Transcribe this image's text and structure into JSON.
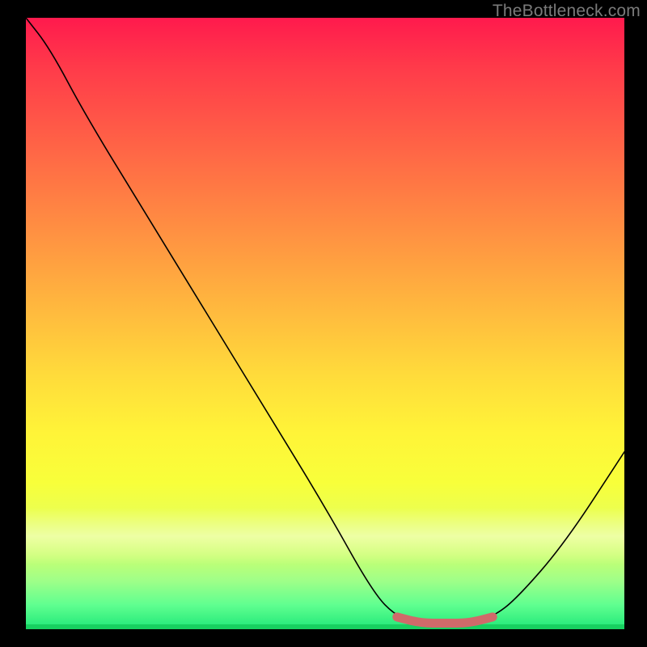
{
  "attribution": "TheBottleneck.com",
  "colors": {
    "frame": "#000000",
    "curve": "#000000",
    "highlight": "#d06a6a",
    "top_gradient": "#ff1a4d",
    "bottom_gradient": "#20e878"
  },
  "chart_data": {
    "type": "line",
    "title": "",
    "xlabel": "",
    "ylabel": "",
    "xlim": [
      0,
      100
    ],
    "ylim": [
      0,
      100
    ],
    "series": [
      {
        "name": "curve",
        "x": [
          0,
          4,
          10,
          20,
          30,
          40,
          50,
          58,
          62,
          66,
          70,
          74,
          78,
          82,
          90,
          100
        ],
        "values": [
          100,
          95,
          84,
          68,
          52,
          36,
          20,
          6,
          2,
          1,
          1,
          1,
          2,
          5,
          14,
          29
        ]
      }
    ],
    "highlight_segment": {
      "x_start": 62,
      "x_end": 78
    },
    "annotations": []
  }
}
